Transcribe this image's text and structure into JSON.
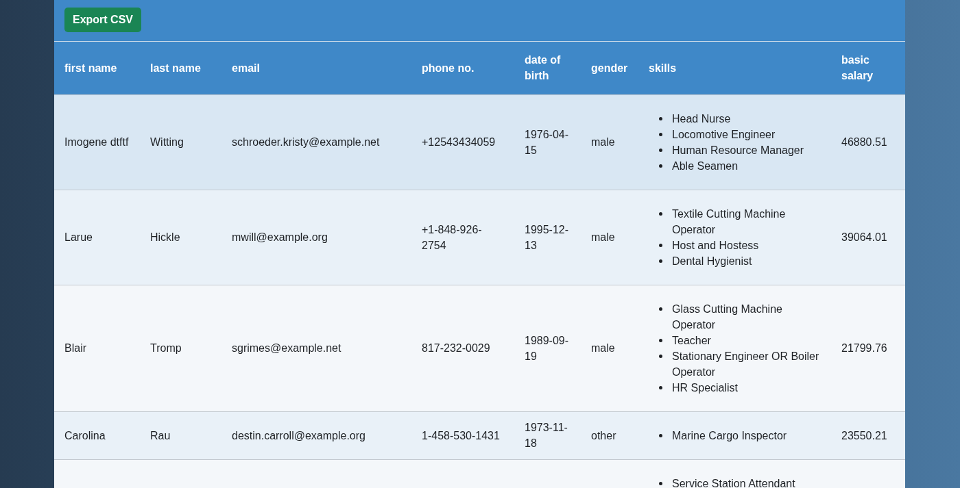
{
  "toolbar": {
    "export_button": "Export CSV"
  },
  "table": {
    "columns": [
      "first name",
      "last name",
      "email",
      "phone no.",
      "date of birth",
      "gender",
      "skills",
      "basic salary"
    ],
    "rows": [
      {
        "selected": true,
        "first_name": "Imogene dtftf",
        "last_name": "Witting",
        "email": "schroeder.kristy@example.net",
        "phone": "+12543434059",
        "date_of_birth": "1976-04-15",
        "gender": "male",
        "skills": [
          "Head Nurse",
          "Locomotive Engineer",
          "Human Resource Manager",
          "Able Seamen"
        ],
        "basic_salary": "46880.51"
      },
      {
        "selected": false,
        "first_name": "Larue",
        "last_name": "Hickle",
        "email": "mwill@example.org",
        "phone": "+1-848-926-2754",
        "date_of_birth": "1995-12-13",
        "gender": "male",
        "skills": [
          "Textile Cutting Machine Operator",
          "Host and Hostess",
          "Dental Hygienist"
        ],
        "basic_salary": "39064.01"
      },
      {
        "selected": false,
        "first_name": "Blair",
        "last_name": "Tromp",
        "email": "sgrimes@example.net",
        "phone": "817-232-0029",
        "date_of_birth": "1989-09-19",
        "gender": "male",
        "skills": [
          "Glass Cutting Machine Operator",
          "Teacher",
          "Stationary Engineer OR Boiler Operator",
          "HR Specialist"
        ],
        "basic_salary": "21799.76"
      },
      {
        "selected": false,
        "first_name": "Carolina",
        "last_name": "Rau",
        "email": "destin.carroll@example.org",
        "phone": "1-458-530-1431",
        "date_of_birth": "1973-11-18",
        "gender": "other",
        "skills": [
          "Marine Cargo Inspector"
        ],
        "basic_salary": "23550.21"
      },
      {
        "selected": false,
        "skills": [
          "Service Station Attendant"
        ]
      }
    ]
  }
}
